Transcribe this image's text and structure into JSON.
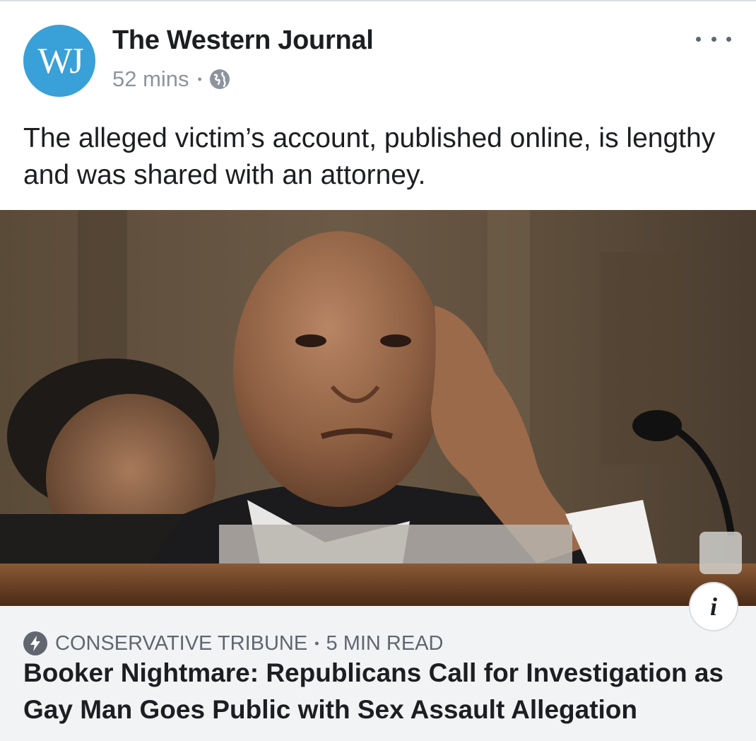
{
  "post": {
    "page_name": "The Western Journal",
    "avatar_text": "WJ",
    "time": "52 mins",
    "separator": "•",
    "audience_icon": "globe-icon",
    "more_icon": "more-options-icon",
    "caption": "The alleged victim’s account, published online, is lengthy and was shared with an attorney."
  },
  "link_preview": {
    "source_icon": "lightning-bolt-icon",
    "source": "CONSERVATIVE TRIBUNE",
    "separator": "•",
    "read_time": "5 MIN READ",
    "headline": "Booker Nightmare: Republicans Call for Investigation as Gay Man Goes Public with Sex Assault Allegation",
    "info_label": "i"
  },
  "colors": {
    "avatar_bg": "#3aa0d8",
    "link_box_bg": "#f2f3f5",
    "secondary_text": "#606770",
    "meta_text": "#8d949e"
  }
}
